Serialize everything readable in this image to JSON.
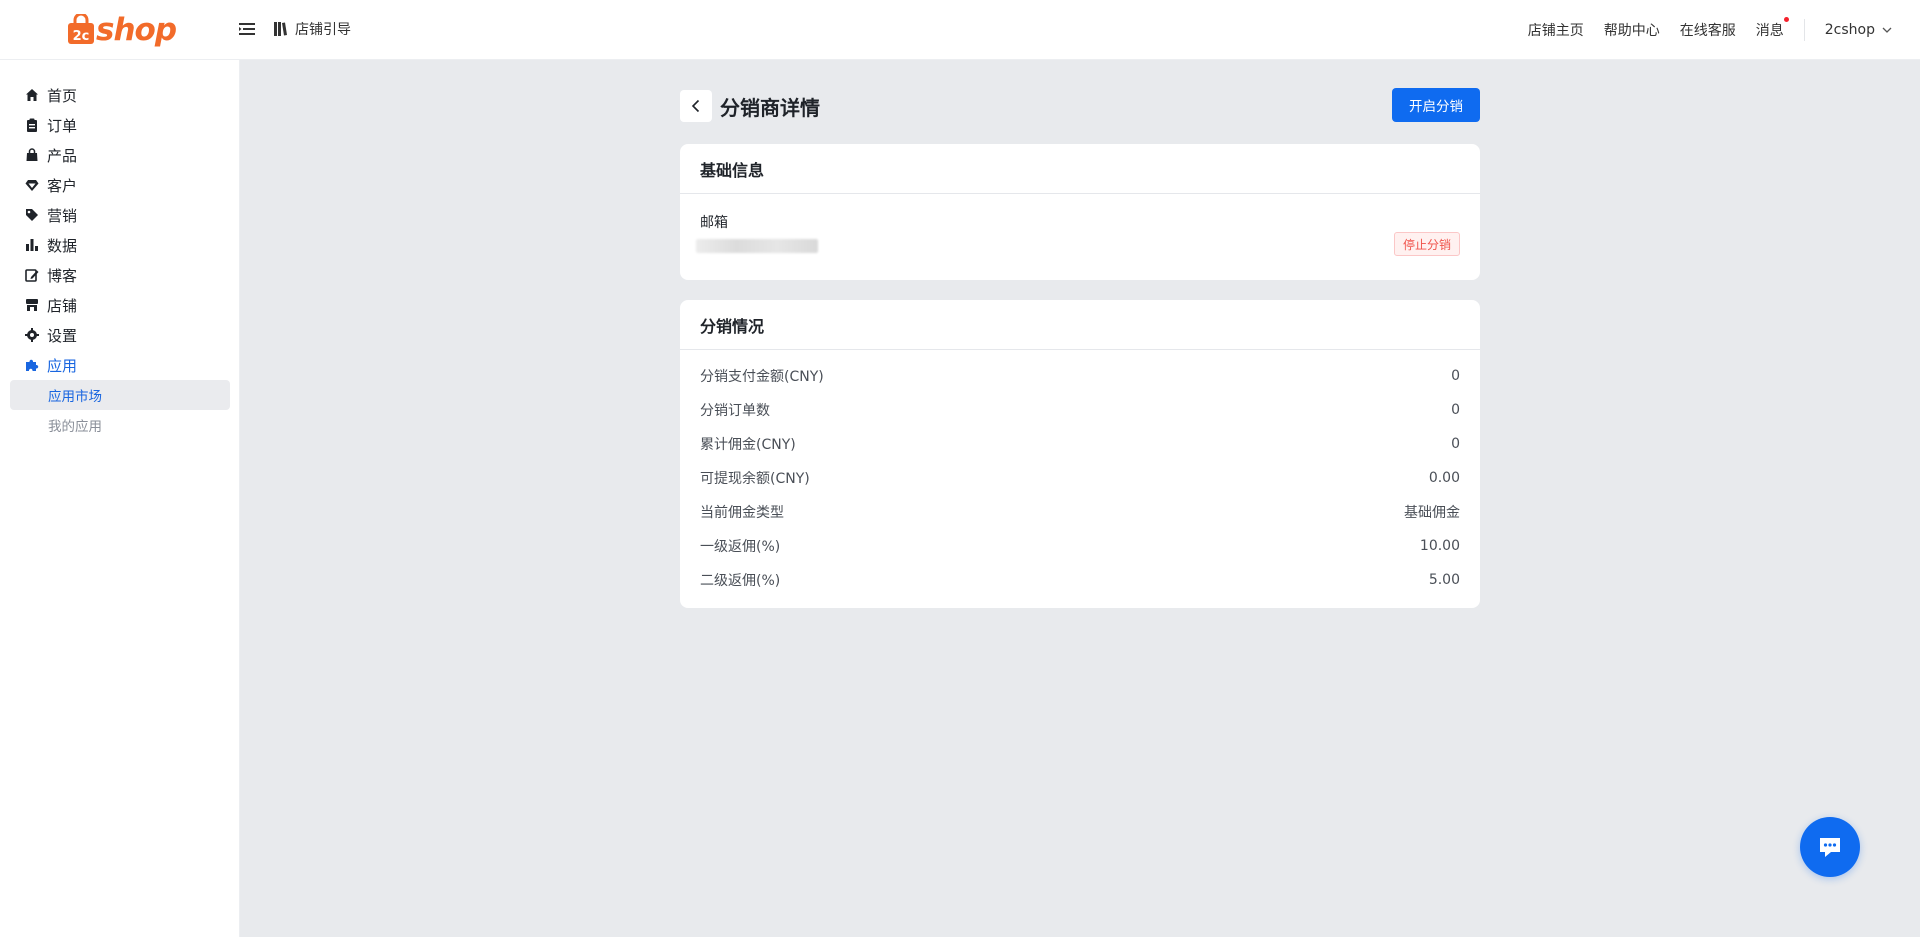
{
  "brand": {
    "logo_text": "shop",
    "accent": "#f26b2a"
  },
  "topbar": {
    "guide_label": "店铺引导",
    "links": [
      "店铺主页",
      "帮助中心",
      "在线客服",
      "消息"
    ],
    "user": "2cshop"
  },
  "sidebar": {
    "items": [
      {
        "label": "首页",
        "icon": "home-icon"
      },
      {
        "label": "订单",
        "icon": "clipboard-icon"
      },
      {
        "label": "产品",
        "icon": "bag-icon"
      },
      {
        "label": "客户",
        "icon": "diamond-icon"
      },
      {
        "label": "营销",
        "icon": "tag-icon"
      },
      {
        "label": "数据",
        "icon": "bar-chart-icon"
      },
      {
        "label": "博客",
        "icon": "edit-icon"
      },
      {
        "label": "店铺",
        "icon": "store-icon"
      },
      {
        "label": "设置",
        "icon": "gear-icon"
      },
      {
        "label": "应用",
        "icon": "puzzle-icon",
        "active": true
      }
    ],
    "sub_items": [
      {
        "label": "应用市场",
        "active": true
      },
      {
        "label": "我的应用"
      }
    ]
  },
  "page": {
    "title": "分销商详情",
    "primary_button": "开启分销",
    "basic_info": {
      "title": "基础信息",
      "email_label": "邮箱",
      "stop_label": "停止分销"
    },
    "stats": {
      "title": "分销情况",
      "rows": [
        {
          "label": "分销支付金额(CNY)",
          "value": "0"
        },
        {
          "label": "分销订单数",
          "value": "0"
        },
        {
          "label": "累计佣金(CNY)",
          "value": "0"
        },
        {
          "label": "可提现余额(CNY)",
          "value": "0.00"
        },
        {
          "label": "当前佣金类型",
          "value": "基础佣金"
        },
        {
          "label": "一级返佣(%)",
          "value": "10.00"
        },
        {
          "label": "二级返佣(%)",
          "value": "5.00"
        }
      ]
    }
  },
  "colors": {
    "primary": "#0f6bf0",
    "danger": "#f0534b",
    "background": "#e8eaed"
  }
}
